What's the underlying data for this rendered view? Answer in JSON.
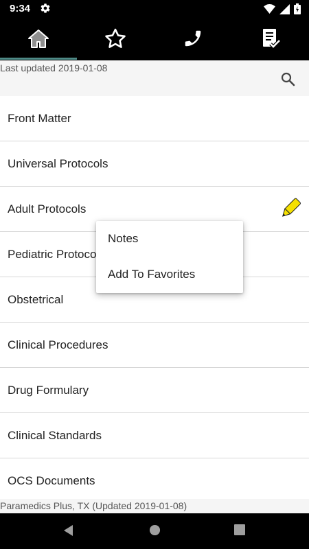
{
  "status_bar": {
    "time": "9:34",
    "icons": [
      "gear-icon",
      "wifi-icon",
      "signal-icon",
      "battery-icon"
    ]
  },
  "tabs": [
    {
      "name": "home",
      "icon": "home-icon",
      "selected": true
    },
    {
      "name": "favorites",
      "icon": "star-icon",
      "selected": false
    },
    {
      "name": "phone",
      "icon": "phone-icon",
      "selected": false
    },
    {
      "name": "checklist",
      "icon": "checklist-icon",
      "selected": false
    }
  ],
  "header": {
    "last_updated": "Last updated 2019-01-08",
    "search_icon": "search-icon"
  },
  "list": {
    "items": [
      {
        "label": "Front Matter"
      },
      {
        "label": "Universal Protocols"
      },
      {
        "label": "Adult Protocols",
        "note_icon": "pencil-icon"
      },
      {
        "label": "Pediatric Protocols"
      },
      {
        "label": "Obstetrical"
      },
      {
        "label": "Clinical Procedures"
      },
      {
        "label": "Drug Formulary"
      },
      {
        "label": "Clinical Standards"
      },
      {
        "label": "OCS Documents"
      }
    ]
  },
  "context_menu": {
    "items": [
      {
        "label": "Notes"
      },
      {
        "label": "Add To Favorites"
      }
    ]
  },
  "footer": {
    "text": "Paramedics Plus, TX (Updated 2019-01-08)"
  },
  "colors": {
    "accent": "#4e8a86",
    "pencil": "#f5e000",
    "bar_background": "#000000"
  }
}
